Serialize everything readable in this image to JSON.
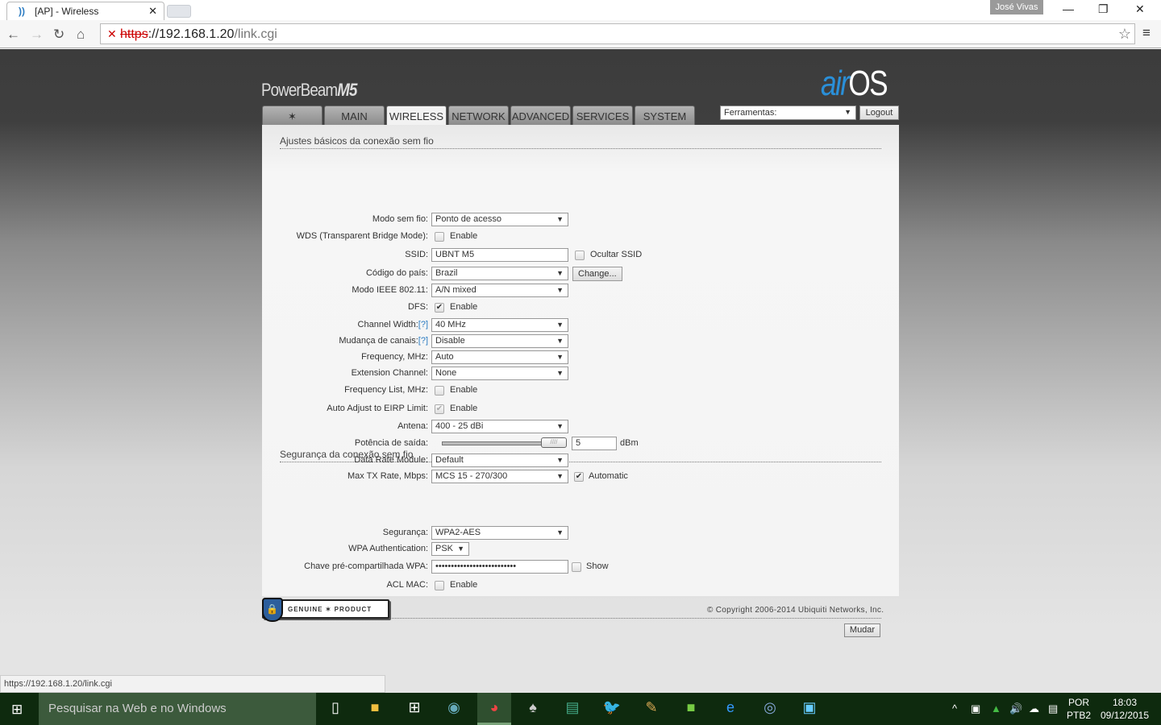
{
  "browser": {
    "tab_title": "[AP] - Wireless",
    "user": "José Vivas",
    "url_scheme": "https",
    "url_host": "://192.168.1.20",
    "url_path": "/link.cgi",
    "status_url": "https://192.168.1.20/link.cgi"
  },
  "header": {
    "brand": "PowerBeam",
    "brand_model": "M5",
    "logo_air": "air",
    "logo_os": "OS",
    "tabs": [
      "",
      "MAIN",
      "WIRELESS",
      "NETWORK",
      "ADVANCED",
      "SERVICES",
      "SYSTEM"
    ],
    "active_tab": "WIRELESS",
    "tools_select": "Ferramentas:",
    "logout": "Logout"
  },
  "basic": {
    "title": "Ajustes básicos da conexão sem fio",
    "rows": [
      {
        "label": "Modo sem fio:",
        "type": "select",
        "value": "Ponto de acesso"
      },
      {
        "label": "WDS (Transparent Bridge Mode):",
        "type": "checkbox",
        "checked": false,
        "text": "Enable"
      },
      {
        "label": "SSID:",
        "type": "input",
        "value": "UBNT M5",
        "extra_checkbox": {
          "text": "Ocultar SSID",
          "checked": false
        }
      },
      {
        "label": "Código do país:",
        "type": "select",
        "value": "Brazil",
        "button": "Change..."
      },
      {
        "label": "Modo IEEE 802.11:",
        "type": "select",
        "value": "A/N mixed"
      },
      {
        "label": "DFS:",
        "type": "checkbox",
        "checked": true,
        "text": "Enable"
      },
      {
        "label": "Channel Width:",
        "help": "[?]",
        "type": "select",
        "value": "40 MHz"
      },
      {
        "label": "Mudança de canais:",
        "help": "[?]",
        "type": "select",
        "value": "Disable"
      },
      {
        "label": "Frequency, MHz:",
        "type": "select",
        "value": "Auto"
      },
      {
        "label": "Extension Channel:",
        "type": "select",
        "value": "None"
      },
      {
        "label": "Frequency List, MHz:",
        "type": "checkbox",
        "checked": false,
        "text": "Enable"
      },
      {
        "label": "Auto Adjust to EIRP Limit:",
        "type": "checkbox",
        "checked": true,
        "disabled": true,
        "text": "Enable"
      },
      {
        "label": "Antena:",
        "type": "select",
        "value": "400 - 25 dBi"
      },
      {
        "label": "Potência de saída:",
        "type": "slider",
        "value": "5",
        "unit": "dBm",
        "slider_fraction": 1.0
      },
      {
        "label": "Data Rate Module:",
        "type": "select",
        "value": "Default"
      },
      {
        "label": "Max TX Rate, Mbps:",
        "type": "select",
        "value": "MCS 15 - 270/300",
        "extra_checkbox": {
          "text": "Automatic",
          "checked": true
        }
      }
    ]
  },
  "security": {
    "title": "Segurança da conexão sem fio",
    "rows": [
      {
        "label": "Segurança:",
        "type": "select",
        "value": "WPA2-AES"
      },
      {
        "label": "WPA Authentication:",
        "type": "select",
        "value": "PSK",
        "narrow": true
      },
      {
        "label": "Chave pré-compartilhada WPA:",
        "type": "input",
        "value": "••••••••••••••••••••••••••",
        "extra_checkbox": {
          "text": "Show",
          "checked": false
        }
      },
      {
        "label": "ACL MAC:",
        "type": "checkbox",
        "checked": false,
        "text": "Enable"
      }
    ]
  },
  "footer": {
    "submit": "Mudar",
    "badge_left": "GENUINE",
    "badge_right": "PRODUCT",
    "copyright": "© Copyright 2006-2014 Ubiquiti Networks, Inc."
  },
  "taskbar": {
    "search_placeholder": "Pesquisar na Web e no Windows",
    "lang": "POR",
    "layout": "PTB2",
    "time": "18:03",
    "date": "09/12/2015"
  }
}
